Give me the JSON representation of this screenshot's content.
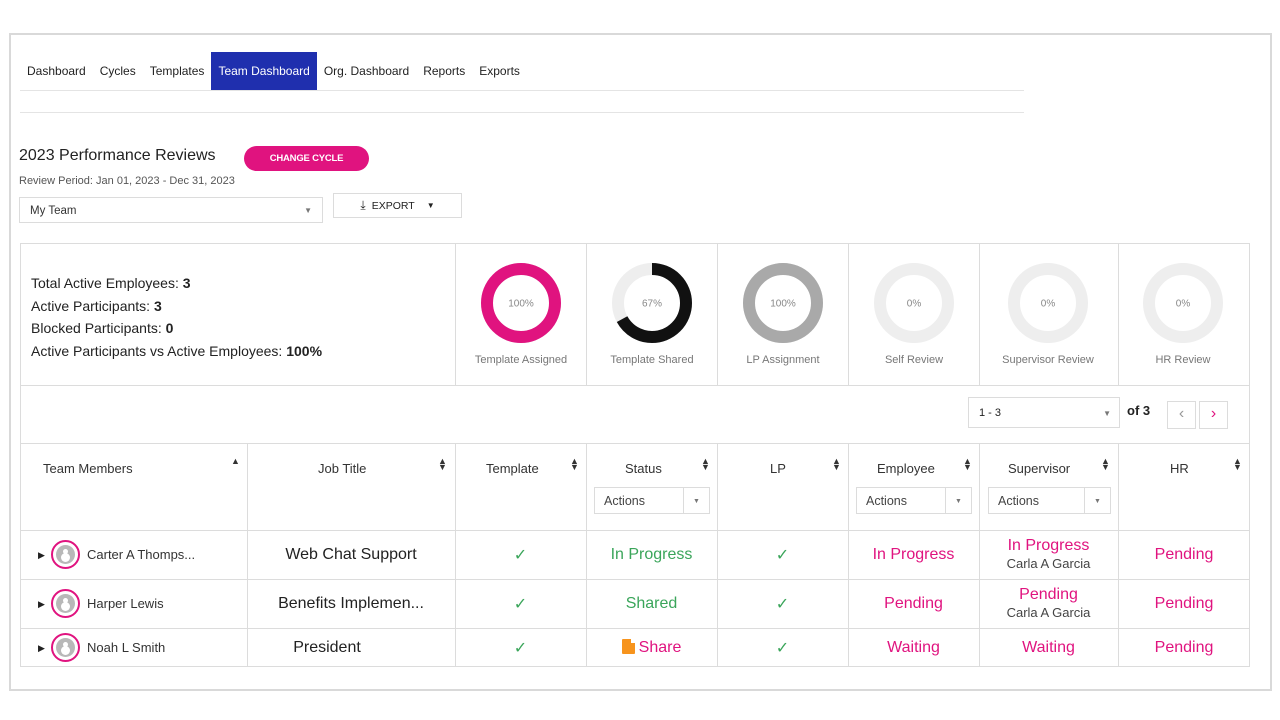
{
  "nav": {
    "tabs": [
      "Dashboard",
      "Cycles",
      "Templates",
      "Team Dashboard",
      "Org. Dashboard",
      "Reports",
      "Exports"
    ],
    "active": "Team Dashboard"
  },
  "header": {
    "title": "2023 Performance Reviews",
    "change_cycle_label": "CHANGE CYCLE",
    "review_period": "Review Period: Jan 01, 2023 - Dec 31, 2023"
  },
  "filters": {
    "team_select": "My Team",
    "export_label": "EXPORT"
  },
  "stats": [
    {
      "label": "Total Active Employees:",
      "value": "3"
    },
    {
      "label": "Active Participants:",
      "value": "3"
    },
    {
      "label": "Blocked Participants:",
      "value": "0"
    },
    {
      "label": "Active Participants vs Active Employees:",
      "value": "100%"
    }
  ],
  "donuts": [
    {
      "label": "Template Assigned",
      "percent_text": "100%",
      "value": 1.0,
      "color": "#e0137f"
    },
    {
      "label": "Template Shared",
      "percent_text": "67%",
      "value": 0.67,
      "color": "#111111"
    },
    {
      "label": "LP Assignment",
      "percent_text": "100%",
      "value": 1.0,
      "color": "#a9a9a9"
    },
    {
      "label": "Self Review",
      "percent_text": "0%",
      "value": 0.0,
      "color": "#eeeeee"
    },
    {
      "label": "Supervisor Review",
      "percent_text": "0%",
      "value": 0.0,
      "color": "#eeeeee"
    },
    {
      "label": "HR Review",
      "percent_text": "0%",
      "value": 0.0,
      "color": "#eeeeee"
    }
  ],
  "pager": {
    "range": "1 - 3",
    "of_text": "of 3"
  },
  "table": {
    "columns": [
      "Team Members",
      "Job Title",
      "Template",
      "Status",
      "LP",
      "Employee",
      "Supervisor",
      "HR"
    ],
    "actions_label": "Actions",
    "rows": [
      {
        "member": "Carter A Thomps...",
        "job": "Web Chat Support",
        "status": "In Progress",
        "employee": "In Progress",
        "supervisor": "In Progress",
        "supervisor_name": "Carla A Garcia",
        "hr": "Pending"
      },
      {
        "member": "Harper Lewis",
        "job": "Benefits Implemen...",
        "status": "Shared",
        "employee": "Pending",
        "supervisor": "Pending",
        "supervisor_name": "Carla A Garcia",
        "hr": "Pending"
      },
      {
        "member": "Noah L Smith",
        "job": "President",
        "status": "Share",
        "employee": "Waiting",
        "supervisor": "Waiting",
        "supervisor_name": "",
        "hr": "Pending"
      }
    ]
  },
  "colors": {
    "accent": "#e0137f",
    "nav_active": "#1f2fae",
    "success": "#3aa55a",
    "warning": "#f7941d"
  }
}
